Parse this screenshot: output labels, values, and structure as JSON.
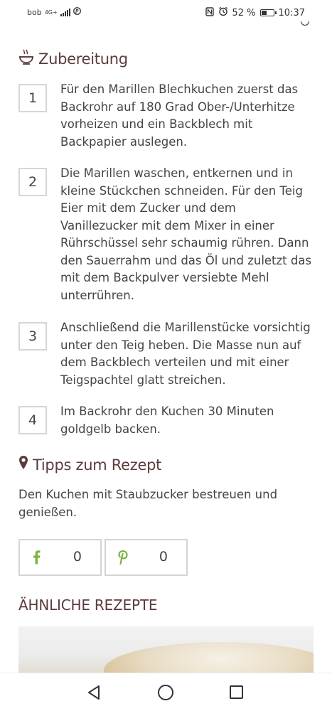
{
  "status_bar": {
    "carrier": "bob",
    "network": "4G+",
    "battery_percent": "52 %",
    "battery_level": 0.52,
    "time": "10:37"
  },
  "preparation": {
    "title": "Zubereitung",
    "icon": "dish-icon",
    "steps": [
      {
        "number": "1",
        "text": "Für den Marillen Blechkuchen zuerst das Backrohr auf 180 Grad Ober-/Unterhitze vorheizen und ein Backblech mit Backpapier auslegen."
      },
      {
        "number": "2",
        "text": "Die Marillen waschen, entkernen und in kleine Stückchen schneiden. Für den Teig Eier mit dem Zucker und dem Vanillezucker mit dem Mixer in einer Rührschüssel sehr schaumig rühren. Dann den Sauerrahm und das Öl und zuletzt das mit dem Backpulver versiebte Mehl unterrühren."
      },
      {
        "number": "3",
        "text": "Anschließend die Marillenstücke vorsichtig unter den Teig heben. Die Masse nun auf dem Backblech verteilen und mit einer Teigspachtel glatt streichen."
      },
      {
        "number": "4",
        "text": "Im Backrohr den Kuchen 30 Minuten goldgelb backen."
      }
    ]
  },
  "tips": {
    "title": "Tipps zum Rezept",
    "icon": "map-pin-icon",
    "text": "Den Kuchen mit Staubzucker bestreuen und genießen."
  },
  "share": {
    "facebook": {
      "icon": "facebook-icon",
      "count": "0"
    },
    "pinterest": {
      "icon": "pinterest-icon",
      "count": "0"
    }
  },
  "similar_recipes": {
    "title": "ÄHNLICHE REZEPTE"
  },
  "colors": {
    "heading": "#5b3b3d",
    "text": "#444444",
    "share_icon": "#7cb342",
    "border": "#d6d6d6"
  },
  "nav_bar": {
    "back_icon": "back-triangle-icon",
    "home_icon": "home-circle-icon",
    "recent_icon": "recent-apps-square-icon"
  }
}
